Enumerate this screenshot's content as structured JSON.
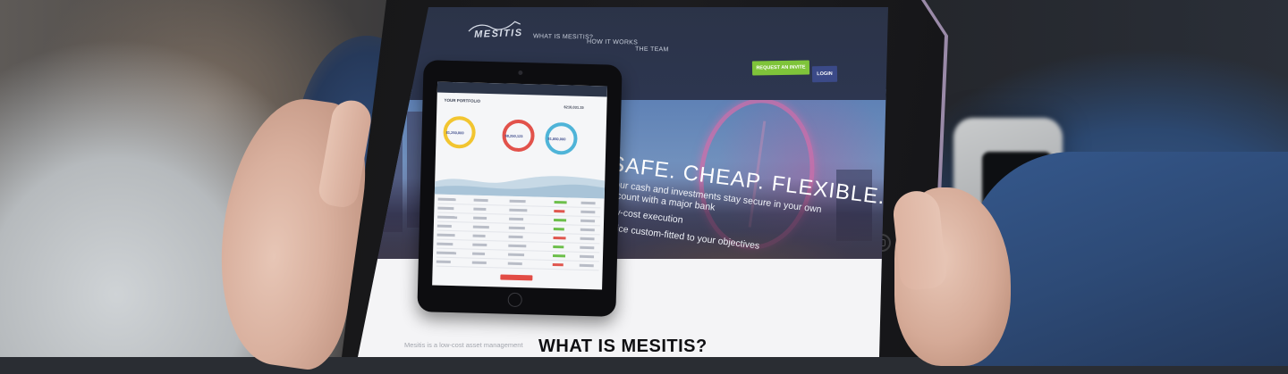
{
  "nav": {
    "logo": "MESITIS",
    "links": [
      "WHAT IS MESITIS?",
      "HOW IT WORKS",
      "THE TEAM"
    ],
    "request_invite": "REQUEST AN INVITE",
    "login": "LOGIN"
  },
  "hero": {
    "headline": "SAFE. CHEAP. FLEXIBLE.",
    "line1": "Your cash and investments stay secure in your own",
    "line2": "account with a major bank",
    "line3": "Low-cost execution",
    "line4": "Advice custom-fitted to your objectives"
  },
  "mini_dashboard": {
    "title": "YOUR PORTFOLIO",
    "ring_values": [
      "$1,250,000",
      "$8,250,123",
      "$1,850,000"
    ],
    "total": "$210,031.15"
  },
  "section": {
    "heading": "WHAT IS MESITIS?",
    "intro": "Mesitis is a low-cost asset management"
  },
  "colors": {
    "nav_bg": "#2b3347",
    "invite_green": "#7fc43a",
    "login_blue": "#3b4a88",
    "ring_yellow": "#f2c530",
    "ring_red": "#e2524b",
    "ring_teal": "#4fb4d8"
  },
  "icons": [
    "logo-mark-icon",
    "camera-icon",
    "home-button-icon"
  ]
}
